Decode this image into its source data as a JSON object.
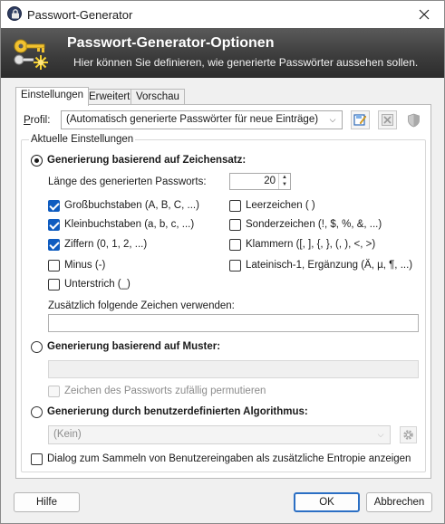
{
  "window": {
    "title": "Passwort-Generator"
  },
  "banner": {
    "title": "Passwort-Generator-Optionen",
    "subtitle": "Hier können Sie definieren, wie generierte Passwörter aussehen sollen."
  },
  "tabs": [
    {
      "label": "Einstellungen",
      "active": true
    },
    {
      "label": "Erweitert",
      "active": false
    },
    {
      "label": "Vorschau",
      "active": false
    }
  ],
  "profile": {
    "label": "Profil:",
    "value": "(Automatisch generierte Passwörter für neue Einträge)"
  },
  "settings_group": {
    "title": "Aktuelle Einstellungen"
  },
  "charset_mode": {
    "label": "Generierung basierend auf Zeichensatz:",
    "selected": true,
    "length_label": "Länge des generierten Passworts:",
    "length_value": "20",
    "options_left": [
      {
        "label": "Großbuchstaben (A, B, C, ...)",
        "checked": true
      },
      {
        "label": "Kleinbuchstaben (a, b, c, ...)",
        "checked": true
      },
      {
        "label": "Ziffern (0, 1, 2, ...)",
        "checked": true
      },
      {
        "label": "Minus (-)",
        "checked": false
      },
      {
        "label": "Unterstrich (_)",
        "checked": false
      }
    ],
    "options_right": [
      {
        "label": "Leerzeichen ( )",
        "checked": false
      },
      {
        "label": "Sonderzeichen (!, $, %, &, ...)",
        "checked": false
      },
      {
        "label": "Klammern ([, ], {, }, (, ), <, >)",
        "checked": false
      },
      {
        "label": "Lateinisch-1, Ergänzung (Ä, µ, ¶, ...)",
        "checked": false
      }
    ],
    "extra_chars_label": "Zusätzlich folgende Zeichen verwenden:",
    "extra_chars_value": ""
  },
  "pattern_mode": {
    "label": "Generierung basierend auf Muster:",
    "selected": false,
    "pattern_value": "",
    "permute_label": "Zeichen des Passworts zufällig permutieren",
    "permute_checked": false
  },
  "algorithm_mode": {
    "label": "Generierung durch benutzerdefinierten Algorithmus:",
    "selected": false,
    "algorithm_value": "(Kein)"
  },
  "entropy": {
    "label": "Dialog zum Sammeln von Benutzereingaben als zusätzliche Entropie anzeigen",
    "checked": false
  },
  "buttons": {
    "help": "Hilfe",
    "ok": "OK",
    "cancel": "Abbrechen"
  }
}
